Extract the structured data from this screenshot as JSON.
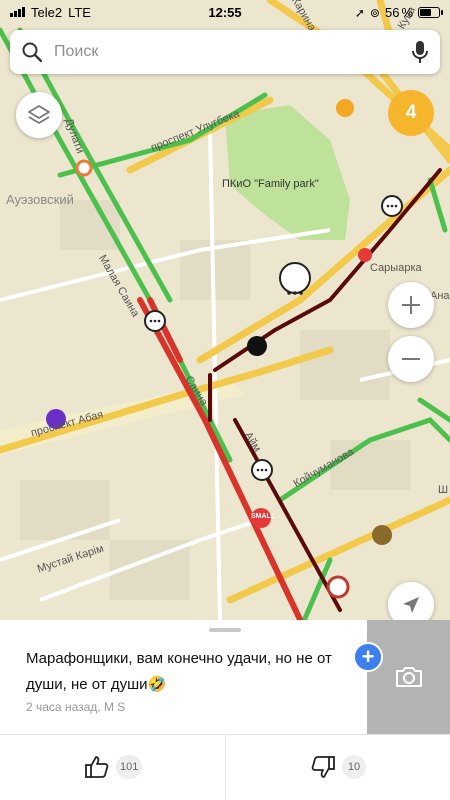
{
  "status_bar": {
    "carrier": "Tele2",
    "network": "LTE",
    "time": "12:55",
    "battery_percent": "56"
  },
  "search": {
    "placeholder": "Поиск"
  },
  "map": {
    "event_count": "4",
    "labels": {
      "district": "Ауэзовский",
      "avenue_ulugbek": "проспект Улугбека",
      "avenue_abay": "проспект Абая",
      "street_dulati": "Дулати",
      "street_malaya_saina": "Малая Саина",
      "street_saina": "Саина",
      "street_koychumanova": "Койчуманова",
      "street_mustai_karim": "Мустай Кәрім",
      "park": "ПКиО \"Family park\"",
      "metro": "Сарыарка",
      "street_top": "Карина",
      "street_top_right": "Кува",
      "street_right": "Ана",
      "street_right_lower": "Ш",
      "street_lower_middle": "Айм",
      "shop": "SMALL"
    }
  },
  "comment": {
    "text": "Марафонщики, вам конечно удачи, но не от души, не от души🤣",
    "meta": "2 часа назад, M S",
    "likes": "101",
    "dislikes": "10"
  },
  "colors": {
    "map_background": "#ece6cf",
    "road_yellow": "#f3c94c",
    "traffic_green": "#4cc04c",
    "traffic_red": "#d9342b",
    "traffic_darkred": "#5a0a0a",
    "badge_orange": "#f5b52c",
    "accent_blue": "#3d7ff0"
  }
}
